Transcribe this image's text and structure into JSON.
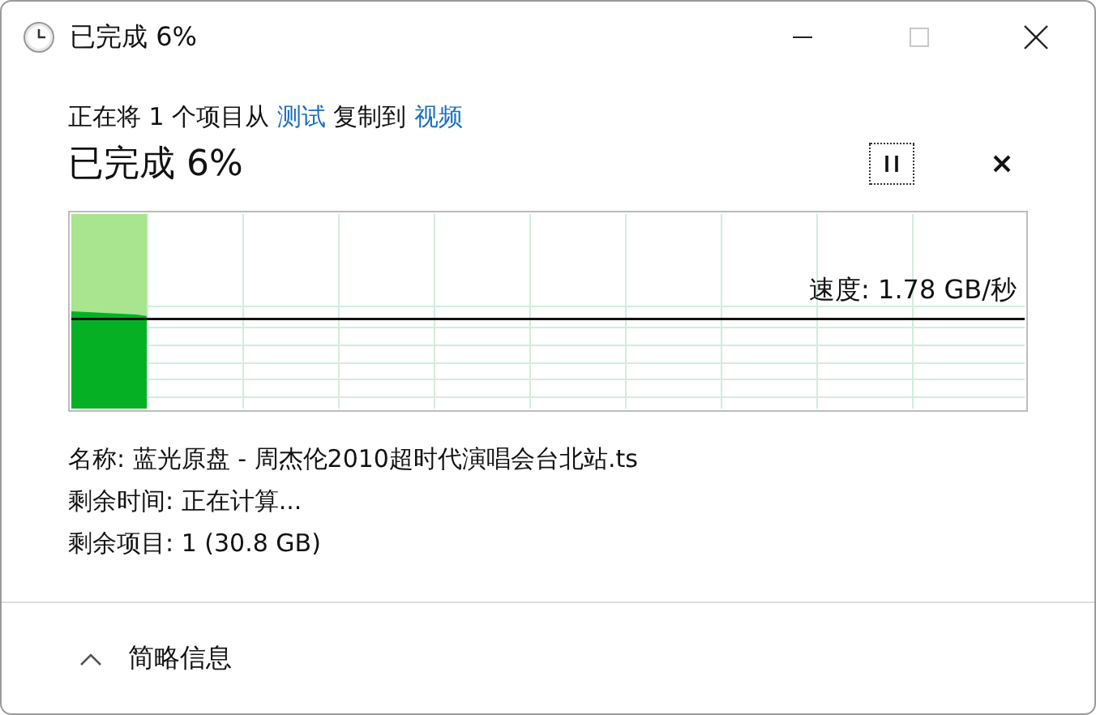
{
  "window": {
    "title": "已完成 6%",
    "maximize_disabled": true
  },
  "copy_line": [
    {
      "kind": "plain",
      "text": "正在将 1 个项目从 "
    },
    {
      "kind": "link",
      "text": "测试"
    },
    {
      "kind": "plain",
      "text": " 复制到 "
    },
    {
      "kind": "link",
      "text": "视频"
    }
  ],
  "heading": "已完成 6%",
  "progress": {
    "level": 0.08,
    "speed": "速度: 1.78 GB/秒"
  },
  "details": [
    "名称: 蓝光原盘 - 周杰伦2010超时代演唱会台北站.ts",
    "剩余时间: 正在计算...",
    "剩余项目: 1 (30.8 GB)"
  ],
  "footer": {
    "label": "简略信息",
    "expanded": true
  }
}
